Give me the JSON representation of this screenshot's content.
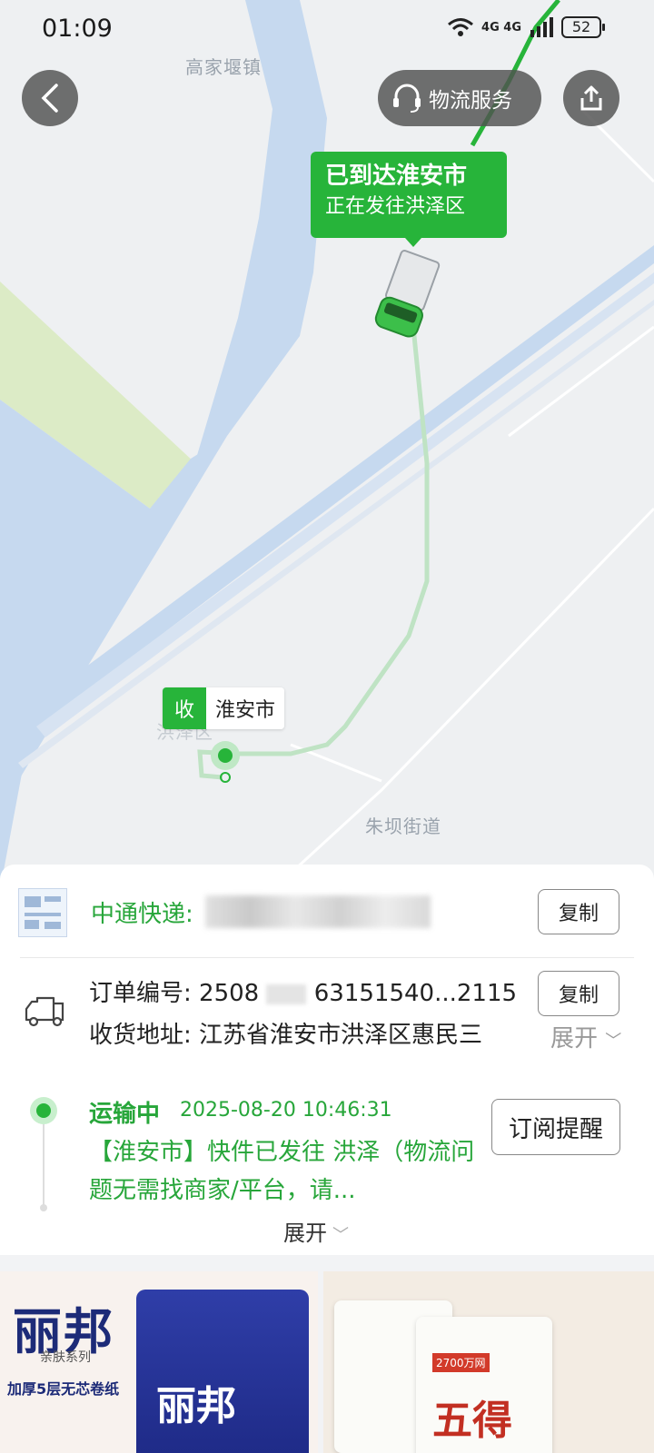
{
  "status_bar": {
    "time": "01:09",
    "signal": "4G 4G",
    "battery": "52"
  },
  "map": {
    "labels": {
      "town_north": "高家堰镇",
      "street": "朱坝街道",
      "district_partial": "洪泽区"
    },
    "colors": {
      "water": "#c6d9ef",
      "green": "#dcebc6",
      "route": "#27b43a"
    }
  },
  "header": {
    "service_label": "物流服务"
  },
  "callout": {
    "title": "已到达淮安市",
    "subtitle": "正在发往洪泽区"
  },
  "receive_tag": {
    "badge": "收",
    "city": "淮安市"
  },
  "shipment": {
    "courier": "中通快递:",
    "copy_label": "复制",
    "order_label": "订单编号: 2508",
    "order_number": "63151540...2115",
    "address": "收货地址: 江苏省淮安市洪泽区惠民三",
    "expand_label": "展开"
  },
  "tracking": {
    "status": "运输中",
    "time": "2025-08-20 10:46:31",
    "desc": "【淮安市】快件已发往 洪泽（物流问题无需找商家/平台，请...",
    "subscribe_label": "订阅提醒",
    "expand_label": "展开"
  },
  "products": [
    {
      "brand": "丽邦",
      "series": "亲肤系列",
      "tag": "加厚5层无芯卷纸",
      "pack_logo": "丽邦"
    },
    {
      "brand_char": "五得",
      "badge": "2700万网"
    }
  ]
}
